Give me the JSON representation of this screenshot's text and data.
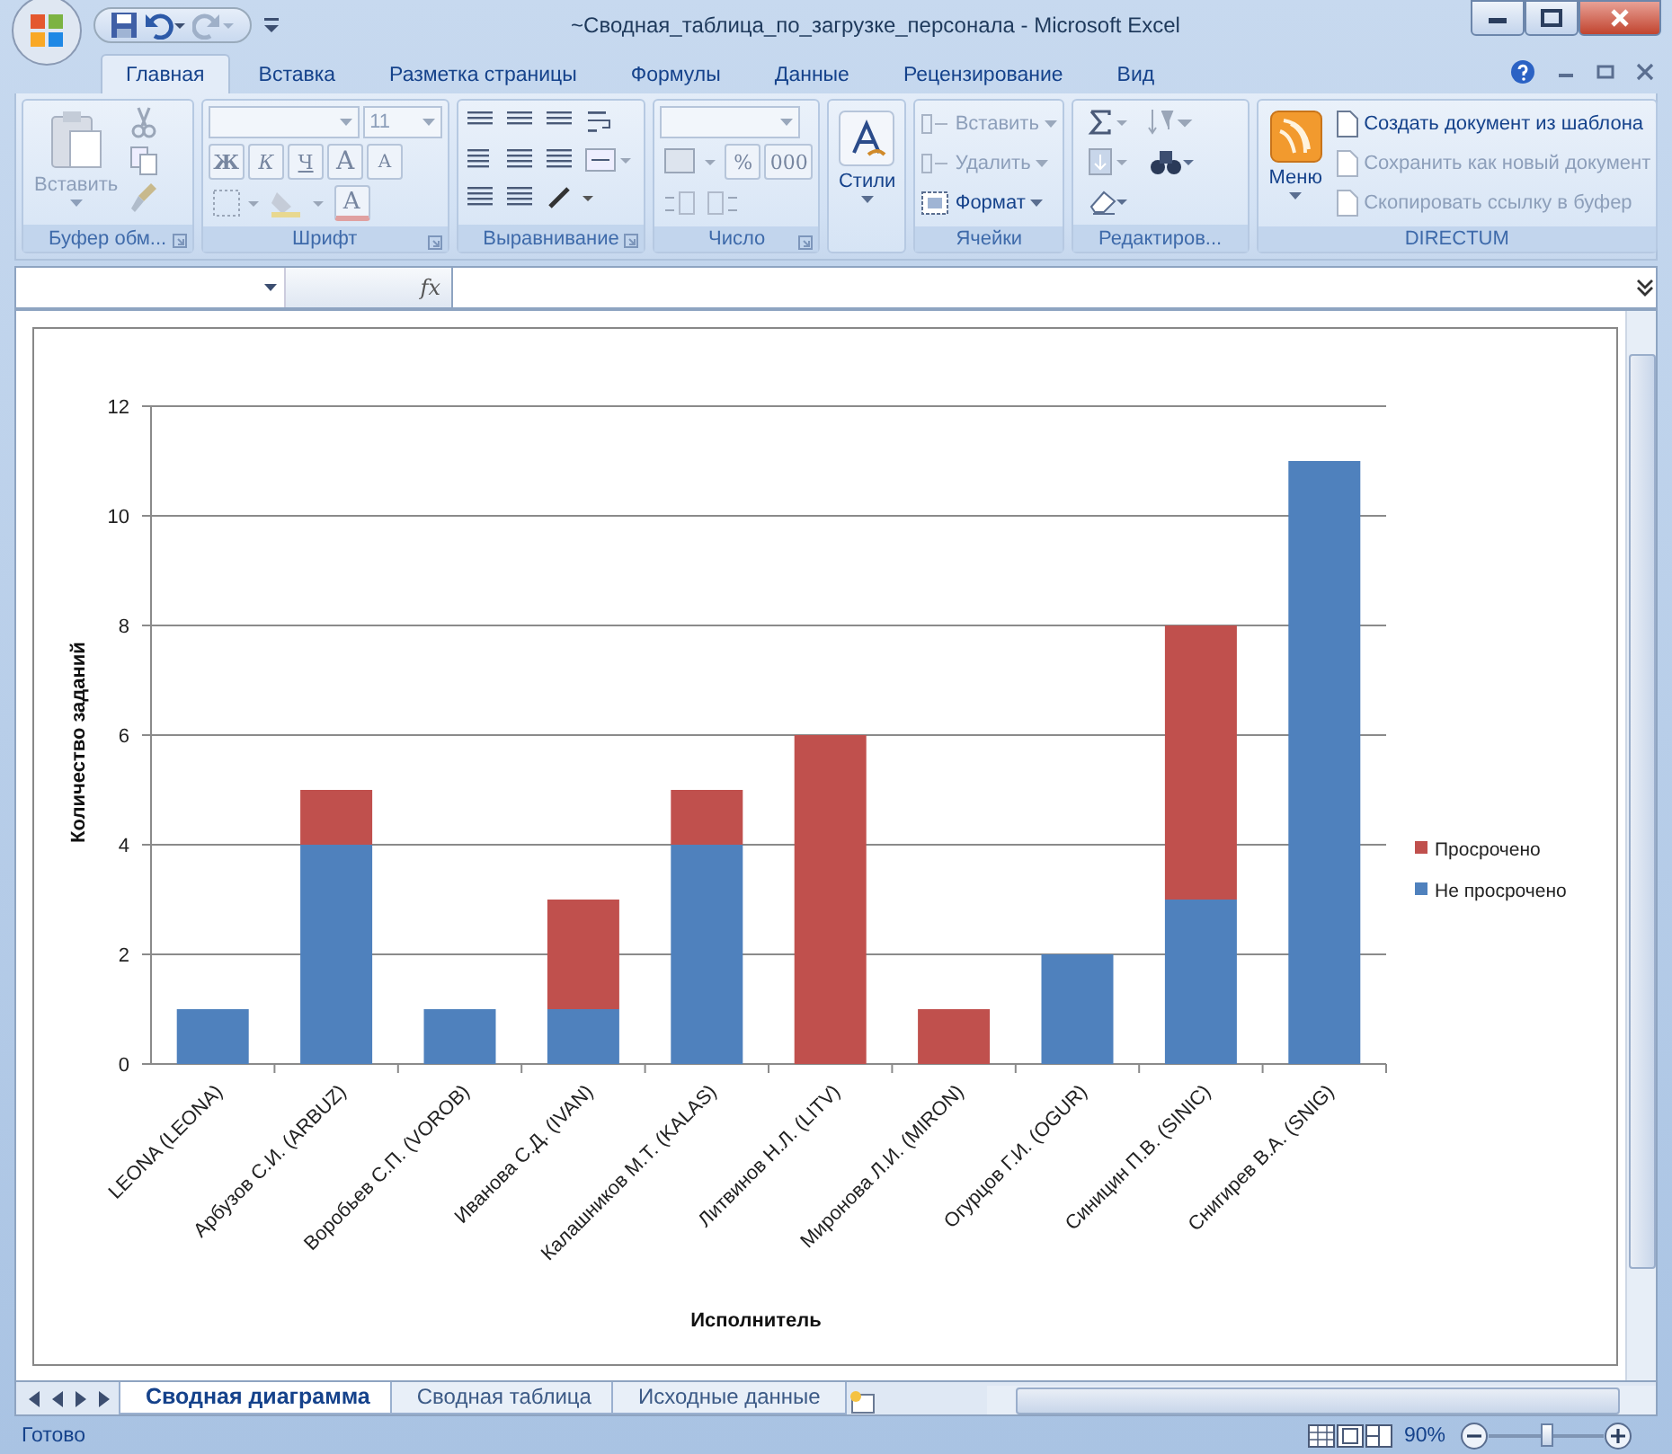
{
  "window": {
    "title": "~Сводная_таблица_по_загрузке_персонала - Microsoft Excel"
  },
  "tabs": [
    {
      "label": "Главная",
      "selected": true
    },
    {
      "label": "Вставка",
      "selected": false
    },
    {
      "label": "Разметка страницы",
      "selected": false
    },
    {
      "label": "Формулы",
      "selected": false
    },
    {
      "label": "Данные",
      "selected": false
    },
    {
      "label": "Рецензирование",
      "selected": false
    },
    {
      "label": "Вид",
      "selected": false
    }
  ],
  "ribbon": {
    "groups": [
      {
        "kind": "clipboard",
        "label": "Буфер обм...",
        "paste": {
          "label": "Вставить",
          "disabled": true
        }
      },
      {
        "kind": "font",
        "label": "Шрифт",
        "size": "11",
        "bold": "Ж",
        "italic": "К",
        "underline": "Ч",
        "grow": "A",
        "shrink": "A",
        "font_color_glyph": "A"
      },
      {
        "kind": "alignment",
        "label": "Выравнивание"
      },
      {
        "kind": "number",
        "label": "Число",
        "percent": "%",
        "thousands": "000"
      },
      {
        "kind": "styles",
        "button": "Стили"
      },
      {
        "kind": "cells",
        "label": "Ячейки",
        "items": [
          {
            "label": "Вставить",
            "disabled": true
          },
          {
            "label": "Удалить",
            "disabled": true
          },
          {
            "label": "Формат",
            "disabled": false
          }
        ]
      },
      {
        "kind": "editing",
        "label": "Редактиров..."
      },
      {
        "kind": "directum",
        "label": "DIRECTUM",
        "menu": "Меню",
        "items": [
          {
            "label": "Создать документ из шаблона",
            "disabled": false
          },
          {
            "label": "Сохранить как новый документ",
            "disabled": true
          },
          {
            "label": "Скопировать ссылку в буфер",
            "disabled": true
          }
        ]
      }
    ]
  },
  "formula_bar": {
    "function_label": "fx"
  },
  "chart": {
    "chart_data": {
      "type": "bar",
      "stacked": true,
      "xlabel": "Исполнитель",
      "ylabel": "Количество заданий",
      "categories": [
        "LEONA (LEONA)",
        "Арбузов С.И. (ARBUZ)",
        "Воробьев С.П. (VOROB)",
        "Иванова С.Д. (IVAN)",
        "Калашников М.Т. (KALAS)",
        "Литвинов Н.Л. (LITV)",
        "Миронова Л.И. (MIRON)",
        "Огурцов Г.И. (OGUR)",
        "Синицин П.В. (SINIC)",
        "Снигирев В.А. (SNIG)"
      ],
      "series": [
        {
          "name": "Не просрочено",
          "color": "#4f81bd",
          "values": [
            1,
            4,
            1,
            1,
            4,
            0,
            0,
            2,
            3,
            11
          ]
        },
        {
          "name": "Просрочено",
          "color": "#c0504d",
          "values": [
            0,
            1,
            0,
            2,
            1,
            6,
            1,
            0,
            5,
            0
          ]
        }
      ],
      "ylim": [
        0,
        12
      ],
      "yticks": [
        0,
        2,
        4,
        6,
        8,
        10,
        12
      ],
      "grid": true,
      "legend": true
    }
  },
  "sheet_tabs": [
    {
      "label": "Сводная диаграмма",
      "selected": true
    },
    {
      "label": "Сводная таблица",
      "selected": false
    },
    {
      "label": "Исходные данные",
      "selected": false
    }
  ],
  "status_bar": {
    "text": "Готово",
    "zoom": "90%",
    "zoom_slider": {
      "level": 0.5
    }
  }
}
